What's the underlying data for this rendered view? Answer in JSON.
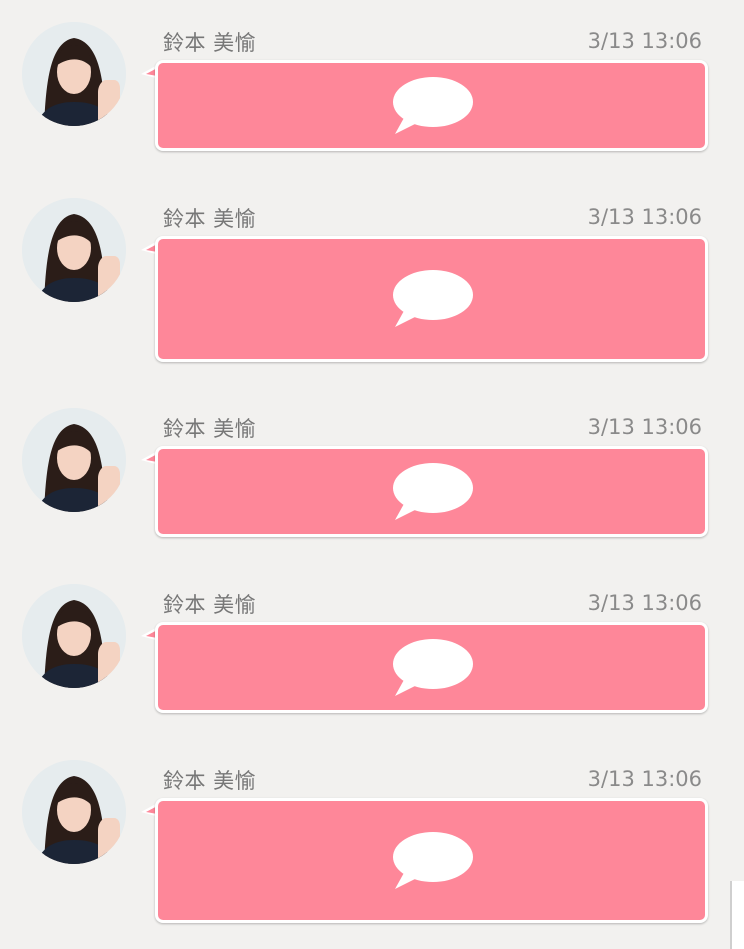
{
  "messages": [
    {
      "sender": "鈴本 美愉",
      "time": "3/13 13:06",
      "icon": "speech-bubble-icon"
    },
    {
      "sender": "鈴本 美愉",
      "time": "3/13 13:06",
      "icon": "speech-bubble-icon"
    },
    {
      "sender": "鈴本 美愉",
      "time": "3/13 13:06",
      "icon": "speech-bubble-icon"
    },
    {
      "sender": "鈴本 美愉",
      "time": "3/13 13:06",
      "icon": "speech-bubble-icon"
    },
    {
      "sender": "鈴本 美愉",
      "time": "3/13 13:06",
      "icon": "speech-bubble-icon"
    }
  ],
  "colors": {
    "bubble": "#fe8799",
    "background": "#f2f1ef",
    "name_text": "#777777",
    "time_text": "#8a8a8a"
  }
}
